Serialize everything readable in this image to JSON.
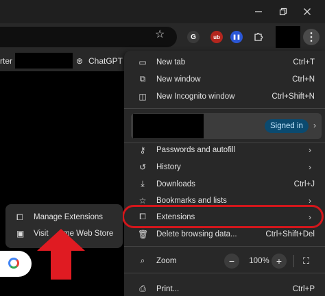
{
  "window": {
    "minimize_icon": "minimize-icon",
    "restore_icon": "restore-icon",
    "close_icon": "close-icon"
  },
  "toolbar": {
    "bookmark_star_icon": "star-icon",
    "extensions": [
      {
        "icon": "grammarly-icon",
        "glyph": "G",
        "color": "#3a3a3a"
      },
      {
        "icon": "ublock-icon",
        "glyph": "ub",
        "color": "#b3261e"
      },
      {
        "icon": "pause-extension-icon",
        "glyph": "❚❚",
        "color": "#2b57d6"
      },
      {
        "icon": "puzzle-extensions-icon",
        "glyph": "",
        "color": ""
      }
    ],
    "menu_icon": "more-vert-icon"
  },
  "bookmarks": {
    "partial_item": "rter",
    "chatgpt": "ChatGPT"
  },
  "menu": {
    "new_tab": {
      "label": "New tab",
      "shortcut": "Ctrl+T"
    },
    "new_window": {
      "label": "New window",
      "shortcut": "Ctrl+N"
    },
    "incognito": {
      "label": "New Incognito window",
      "shortcut": "Ctrl+Shift+N"
    },
    "profile": {
      "status": "Signed in"
    },
    "passwords": {
      "label": "Passwords and autofill"
    },
    "history": {
      "label": "History"
    },
    "downloads": {
      "label": "Downloads",
      "shortcut": "Ctrl+J"
    },
    "bookmarks": {
      "label": "Bookmarks and lists"
    },
    "extensions": {
      "label": "Extensions"
    },
    "delete_data": {
      "label": "Delete browsing data...",
      "shortcut": "Ctrl+Shift+Del"
    },
    "zoom": {
      "label": "Zoom",
      "minus": "−",
      "value": "100%",
      "plus": "+"
    },
    "print": {
      "label": "Print...",
      "shortcut": "Ctrl+P"
    }
  },
  "popup": {
    "manage": "Manage Extensions",
    "store_left": "Visit",
    "store_right": "me Web Store"
  },
  "colors": {
    "accent_highlight": "#d4161b",
    "signed_in_bg": "#0b4a6f",
    "arrow": "#e01b22"
  }
}
